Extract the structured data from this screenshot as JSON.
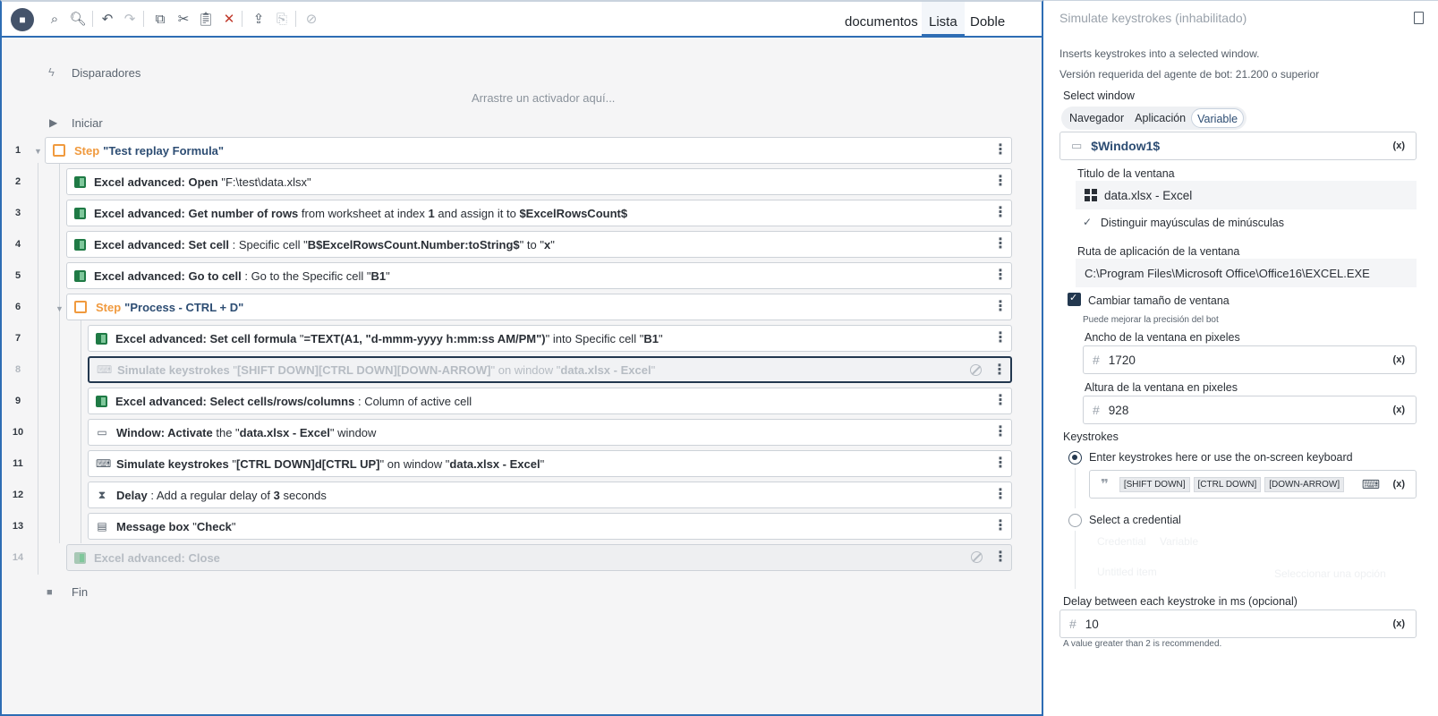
{
  "toolbar": {
    "view_tabs": [
      "documentos",
      "Lista",
      "Doble"
    ],
    "active_view": "Lista"
  },
  "flow": {
    "triggers_label": "Disparadores",
    "drop_hint": "Arrastre un activador aquí...",
    "start_label": "Iniciar",
    "end_label": "Fin",
    "line_numbers": [
      "1",
      "2",
      "3",
      "4",
      "5",
      "6",
      "7",
      "8",
      "9",
      "10",
      "11",
      "12",
      "13",
      "14"
    ],
    "step1": {
      "word": "Step",
      "name": "\"Test replay Formula\""
    },
    "row2": {
      "bold": "Excel advanced: Open",
      "val": "\"F:\\test\\data.xlsx\""
    },
    "row3": {
      "bold": "Excel advanced: Get number of rows",
      "t1": " from worksheet at index ",
      "v1": "1",
      "t2": " and assign it to ",
      "v2": "$ExcelRowsCount$"
    },
    "row4": {
      "bold": "Excel advanced: Set cell",
      "t1": " : Specific cell \"",
      "v1": "B$ExcelRowsCount.Number:toString$",
      "t2": "\" to \"",
      "v2": "x",
      "t3": "\""
    },
    "row5": {
      "bold": "Excel advanced: Go to cell",
      "t1": " : Go to the Specific cell \"",
      "v1": "B1",
      "t2": "\""
    },
    "step6": {
      "word": "Step",
      "name": "\"Process - CTRL + D\""
    },
    "row7": {
      "bold": "Excel advanced: Set cell formula",
      "t1": " \"",
      "v1": "=TEXT(A1, \"d-mmm-yyyy h:mm:ss AM/PM\")",
      "t2": "\" into Specific cell \"",
      "v2": "B1",
      "t3": "\""
    },
    "row8": {
      "bold": "Simulate keystrokes",
      "t1": " \"",
      "v1": "[SHIFT DOWN][CTRL DOWN][DOWN-ARROW]",
      "t2": "\" on window \"",
      "v2": "data.xlsx - Excel",
      "t3": "\""
    },
    "row9": {
      "bold": "Excel advanced: Select cells/rows/columns",
      "t1": " : Column of active cell"
    },
    "row10": {
      "bold": "Window: Activate",
      "t1": " the \"",
      "v1": "data.xlsx - Excel",
      "t2": "\" window"
    },
    "row11": {
      "bold": "Simulate keystrokes",
      "t1": " \"",
      "v1": "[CTRL DOWN]d[CTRL UP]",
      "t2": "\" on window \"",
      "v2": "data.xlsx - Excel",
      "t3": "\""
    },
    "row12": {
      "bold": "Delay",
      "t1": " : Add a regular delay of ",
      "v1": "3",
      "t2": " seconds"
    },
    "row13": {
      "bold": "Message box",
      "t1": " \"",
      "v1": "Check",
      "t2": "\""
    },
    "row14": {
      "bold": "Excel advanced: Close"
    }
  },
  "panel": {
    "title": "Simulate keystrokes (inhabilitado)",
    "description": "Inserts keystrokes into a selected window.",
    "version": "Versión requerida del agente de bot: 21.200 o superior",
    "select_window_label": "Select window",
    "window_options": [
      "Navegador",
      "Aplicación",
      "Variable"
    ],
    "selected_window_option": "Variable",
    "window_variable": "$Window1$",
    "fx_label": "(x)",
    "title_label": "Titulo de la ventana",
    "title_value": "data.xlsx - Excel",
    "case_label": "Distinguir mayúsculas de minúsculas",
    "path_label": "Ruta de aplicación de la ventana",
    "path_value": "C:\\Program Files\\Microsoft Office\\Office16\\EXCEL.EXE",
    "resize_label": "Cambiar tamaño de ventana",
    "resize_hint": "Puede mejorar la precisión del bot",
    "width_label": "Ancho de la ventana en pixeles",
    "width_value": "1720",
    "height_label": "Altura de la ventana en pixeles",
    "height_value": "928",
    "keystrokes_label": "Keystrokes",
    "enter_keystrokes_label": "Enter keystrokes here or use the on-screen keyboard",
    "keystroke_chips": [
      "[SHIFT DOWN]",
      "[CTRL DOWN]",
      "[DOWN-ARROW]"
    ],
    "credential_label": "Select a credential",
    "credential_ghost": [
      "Credential",
      "Variable",
      "Untitled item",
      "Seleccionar una opción"
    ],
    "delay_label": "Delay between each keystroke in ms (opcional)",
    "delay_value": "10",
    "delay_hint": "A value greater than 2 is recommended."
  },
  "colors": {
    "accent": "#2e6db4",
    "step": "#f09a3e",
    "excel": "#1f7a45",
    "navy": "#23384f"
  }
}
